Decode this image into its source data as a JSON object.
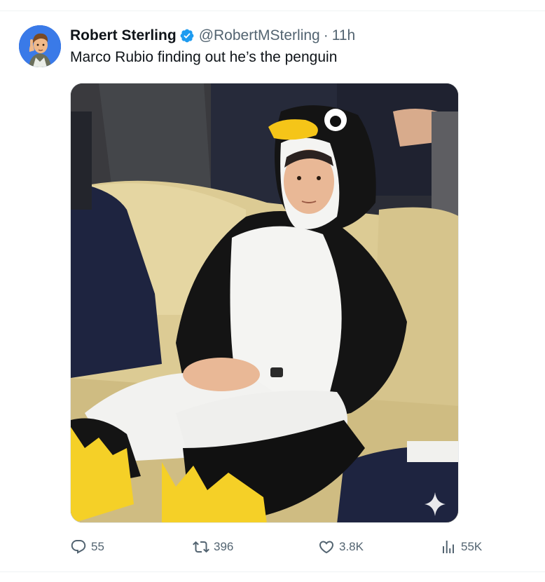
{
  "tweet": {
    "author": {
      "display_name": "Robert Sterling",
      "handle": "@RobertMSterling",
      "verified": true
    },
    "separator": "·",
    "time": "11h",
    "text": "Marco Rubio finding out he’s the penguin",
    "media": {
      "kind": "photo",
      "badge_icon": "sparkle-icon"
    },
    "actions": {
      "replies": "55",
      "retweets": "396",
      "likes": "3.8K",
      "views": "55K"
    }
  },
  "colors": {
    "text_primary": "#0f1419",
    "text_secondary": "#536471",
    "verified_blue": "#1d9bf0",
    "divider": "#eff3f4"
  }
}
